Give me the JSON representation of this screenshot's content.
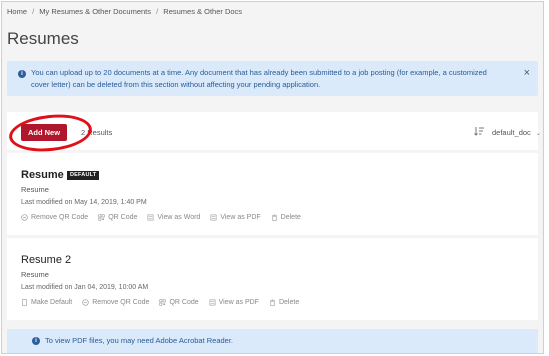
{
  "breadcrumb": {
    "items": [
      "Home",
      "My Resumes & Other Documents",
      "Resumes & Other Docs"
    ],
    "separator": "/"
  },
  "page": {
    "title": "Resumes"
  },
  "info_banner": {
    "text": "You can upload up to 20 documents at a time. Any document that has already been submitted to a job posting (for example, a customized cover letter) can be deleted from this section without affecting your pending application.",
    "close": "×"
  },
  "toolbar": {
    "add_label": "Add New",
    "results_text": "2 Results",
    "sort_value": "default_doc",
    "sort_chevron": "⌄"
  },
  "documents": [
    {
      "title": "Resume",
      "badge": "DEFAULT",
      "type": "Resume",
      "modified": "Last modified on May 14, 2019, 1:40 PM",
      "actions": [
        "Remove QR Code",
        "QR Code",
        "View as Word",
        "View as PDF",
        "Delete"
      ]
    },
    {
      "title": "Resume 2",
      "type": "Resume",
      "modified": "Last modified on Jan 04, 2019, 10:00 AM",
      "actions": [
        "Make Default",
        "Remove QR Code",
        "QR Code",
        "View as PDF",
        "Delete"
      ]
    }
  ],
  "bottom_banner": {
    "text": "To view PDF files, you may need Adobe Acrobat Reader."
  },
  "colors": {
    "accent": "#b0162c",
    "highlight": "#e01018",
    "info_bg": "#dbeafa",
    "info_text": "#2a5a98"
  }
}
